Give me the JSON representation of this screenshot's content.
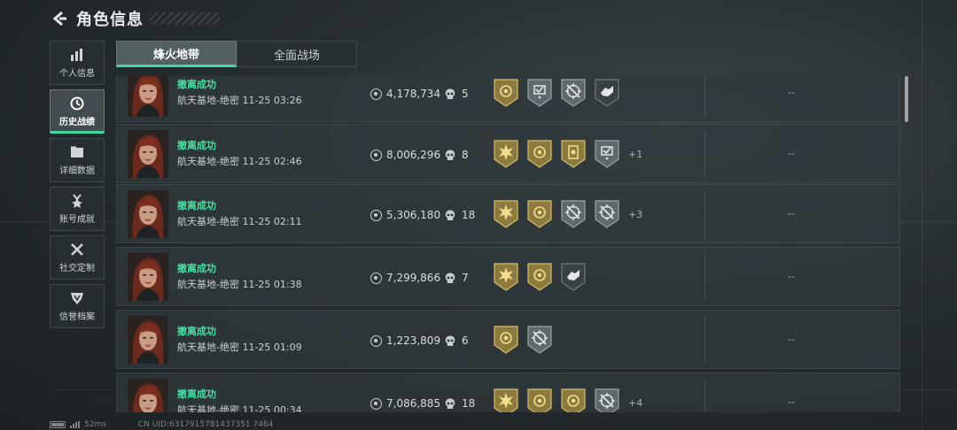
{
  "header": {
    "title": "角色信息"
  },
  "sidebar": {
    "items": [
      {
        "label": "个人信息",
        "icon": "bar-chart-icon",
        "active": false
      },
      {
        "label": "历史战绩",
        "icon": "clock-icon",
        "active": true
      },
      {
        "label": "详细数据",
        "icon": "folder-icon",
        "active": false
      },
      {
        "label": "账号成就",
        "icon": "medal-icon",
        "active": false
      },
      {
        "label": "社交定制",
        "icon": "tools-icon",
        "active": false
      },
      {
        "label": "信誉档案",
        "icon": "shield-icon",
        "active": false
      }
    ]
  },
  "tabs": [
    {
      "label": "烽火地带",
      "active": true
    },
    {
      "label": "全面战场",
      "active": false
    }
  ],
  "records": [
    {
      "status": "撤离成功",
      "info": "航天基地-绝密 11-25 03:26",
      "money": "4,178,734",
      "kills": "5",
      "badges": [
        "gold-target",
        "silver-check",
        "silver-crosshair",
        "dark-hands"
      ],
      "extra": "",
      "result": "--"
    },
    {
      "status": "撤离成功",
      "info": "航天基地-绝密 11-25 02:46",
      "money": "8,006,296",
      "kills": "8",
      "badges": [
        "gold-burst",
        "gold-target",
        "gold-card",
        "silver-check"
      ],
      "extra": "+1",
      "result": "--"
    },
    {
      "status": "撤离成功",
      "info": "航天基地-绝密 11-25 02:11",
      "money": "5,306,180",
      "kills": "18",
      "badges": [
        "gold-burst",
        "gold-target",
        "silver-crosshair",
        "silver-crosshair"
      ],
      "extra": "+3",
      "result": "--"
    },
    {
      "status": "撤离成功",
      "info": "航天基地-绝密 11-25 01:38",
      "money": "7,299,866",
      "kills": "7",
      "badges": [
        "gold-burst",
        "gold-target",
        "dark-hands"
      ],
      "extra": "",
      "result": "--"
    },
    {
      "status": "撤离成功",
      "info": "航天基地-绝密 11-25 01:09",
      "money": "1,223,809",
      "kills": "6",
      "badges": [
        "gold-target",
        "silver-crosshair"
      ],
      "extra": "",
      "result": "--"
    },
    {
      "status": "撤离成功",
      "info": "航天基地-绝密 11-25 00:34",
      "money": "7,086,885",
      "kills": "18",
      "badges": [
        "gold-burst",
        "gold-target",
        "gold-target",
        "silver-crosshair"
      ],
      "extra": "+4",
      "result": "--"
    }
  ],
  "footer": {
    "ping": "52ms",
    "uid": "CN UID:6317915781437351 7464"
  },
  "colors": {
    "accent": "#3fd9a0",
    "gold": "#b49a52",
    "silver": "#6a7377"
  }
}
